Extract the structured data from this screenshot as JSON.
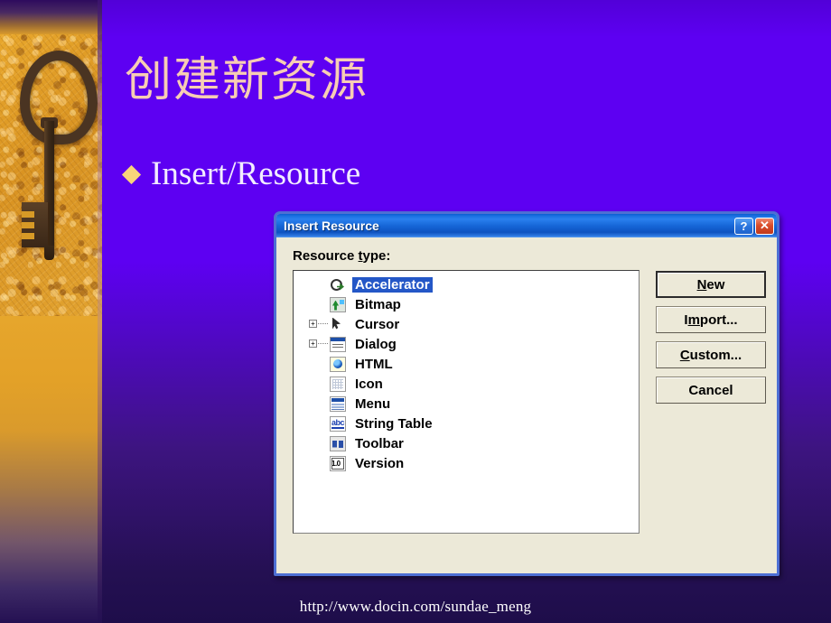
{
  "slide": {
    "title": "创建新资源",
    "bullet": "Insert/Resource",
    "bullet_icon": "diamond-bullet",
    "footer_url": "http://www.docin.com/sundae_meng",
    "background_color": "#5d00f2",
    "title_color": "#f7cdb4",
    "bullet_color": "#f2ecff",
    "accent_color": "#f8d47a"
  },
  "sidebar": {
    "decoration": "antique-key-photo",
    "band_color": "#e3a128"
  },
  "dialog": {
    "title": "Insert Resource",
    "titlebar_buttons": [
      {
        "name": "help-button",
        "glyph": "?"
      },
      {
        "name": "close-button",
        "glyph": "✕"
      }
    ],
    "list_label": "Resource type:",
    "list_label_mnemonic": "t",
    "items": [
      {
        "label": "Accelerator",
        "icon": "accelerator-icon",
        "expandable": false,
        "selected": true
      },
      {
        "label": "Bitmap",
        "icon": "bitmap-icon",
        "expandable": false,
        "selected": false
      },
      {
        "label": "Cursor",
        "icon": "cursor-icon",
        "expandable": true,
        "selected": false
      },
      {
        "label": "Dialog",
        "icon": "dialog-icon",
        "expandable": true,
        "selected": false
      },
      {
        "label": "HTML",
        "icon": "html-icon",
        "expandable": false,
        "selected": false
      },
      {
        "label": "Icon",
        "icon": "icon-icon",
        "expandable": false,
        "selected": false
      },
      {
        "label": "Menu",
        "icon": "menu-icon",
        "expandable": false,
        "selected": false
      },
      {
        "label": "String Table",
        "icon": "string-table-icon",
        "expandable": false,
        "selected": false
      },
      {
        "label": "Toolbar",
        "icon": "toolbar-icon",
        "expandable": false,
        "selected": false
      },
      {
        "label": "Version",
        "icon": "version-icon",
        "expandable": false,
        "selected": false
      }
    ],
    "buttons": [
      {
        "name": "new-button",
        "label": "New",
        "mnemonic": "N",
        "default": true
      },
      {
        "name": "import-button",
        "label": "Import...",
        "mnemonic": "m",
        "default": false
      },
      {
        "name": "custom-button",
        "label": "Custom...",
        "mnemonic": "C",
        "default": false
      },
      {
        "name": "cancel-button",
        "label": "Cancel",
        "mnemonic": "",
        "default": false
      }
    ],
    "expander_glyph": "+",
    "selection_color": "#2457c7"
  }
}
